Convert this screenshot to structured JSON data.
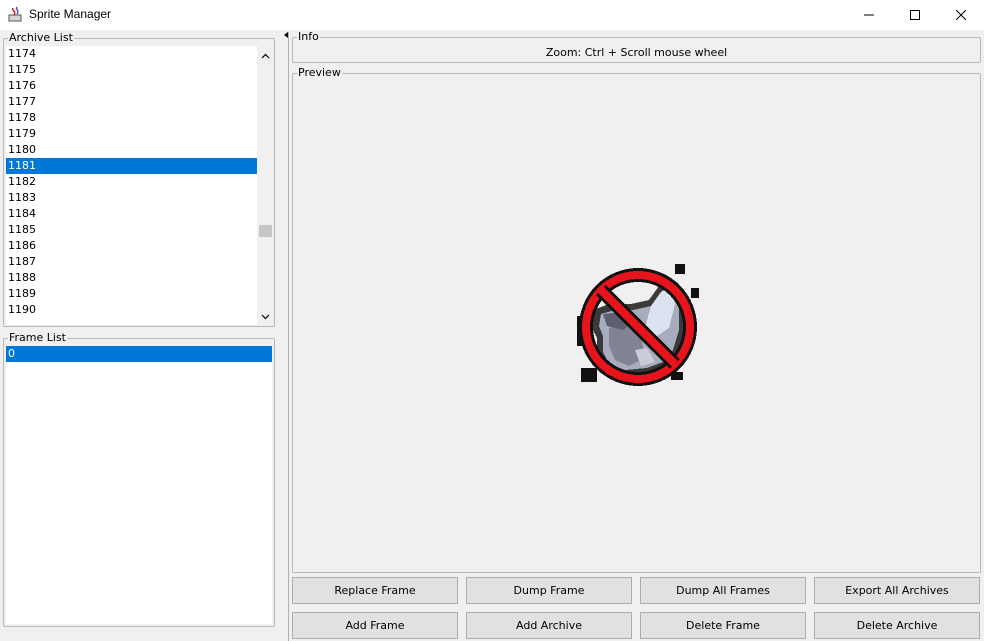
{
  "window": {
    "title": "Sprite Manager",
    "controls": [
      "minimize",
      "maximize",
      "close"
    ]
  },
  "archive_list": {
    "label": "Archive List",
    "items": [
      "1174",
      "1175",
      "1176",
      "1177",
      "1178",
      "1179",
      "1180",
      "1181",
      "1182",
      "1183",
      "1184",
      "1185",
      "1186",
      "1187",
      "1188",
      "1189",
      "1190"
    ],
    "selected": "1181"
  },
  "frame_list": {
    "label": "Frame List",
    "items": [
      "0"
    ],
    "selected": "0"
  },
  "info": {
    "label": "Info",
    "hint": "Zoom: Ctrl + Scroll mouse wheel"
  },
  "preview": {
    "label": "Preview",
    "image_icon": "prohibited-gargoyle-sprite-icon"
  },
  "buttons": {
    "replace_frame": "Replace Frame",
    "dump_frame": "Dump Frame",
    "dump_all_frames": "Dump All Frames",
    "export_all_archives": "Export All Archives",
    "add_frame": "Add Frame",
    "add_archive": "Add Archive",
    "delete_frame": "Delete Frame",
    "delete_archive": "Delete Archive"
  },
  "colors": {
    "selection": "#0078d7",
    "panel": "#f0f0f0",
    "button": "#e1e1e1",
    "prohibition_red": "#e8141c"
  }
}
